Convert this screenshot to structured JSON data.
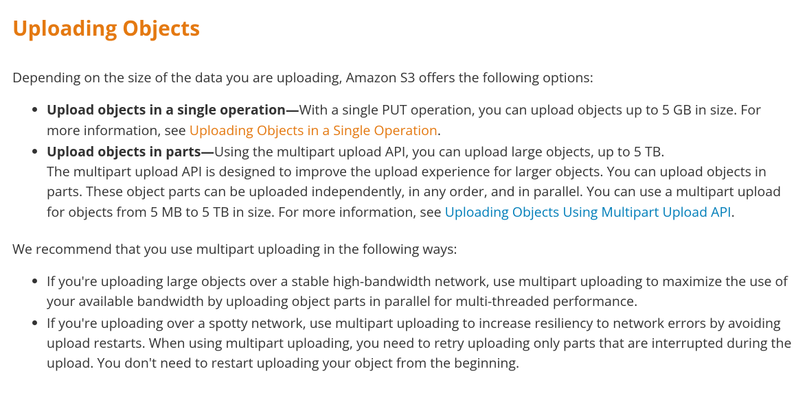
{
  "title": "Uploading Objects",
  "intro": "Depending on the size of the data you are uploading, Amazon S3 offers the following options:",
  "options": [
    {
      "boldPrefix": "Upload objects in a single operation—",
      "textBefore": "With a single PUT operation, you can upload objects up to 5 GB in size. For more information, see ",
      "link": "Uploading Objects in a Single Operation",
      "linkClass": "link-active",
      "textAfter": "."
    },
    {
      "boldPrefix": "Upload objects in parts—",
      "textBefore": "Using the multipart upload API, you can upload large objects, up to 5 TB.\nThe multipart upload API is designed to improve the upload experience for larger objects. You can upload objects in parts. These object parts can be uploaded independently, in any order, and in parallel. You can use a multipart upload for objects from 5 MB to 5 TB in size. For more information, see ",
      "link": "Uploading Objects Using Multipart Upload API",
      "linkClass": "link-visited",
      "textAfter": "."
    }
  ],
  "recommendIntro": "We recommend that you use multipart uploading in the following ways:",
  "recommendations": [
    "If you're uploading large objects over a stable high-bandwidth network, use multipart uploading to maximize the use of your available bandwidth by uploading object parts in parallel for multi-threaded performance.",
    "If you're uploading over a spotty network, use multipart uploading to increase resiliency to network errors by avoiding upload restarts. When using multipart uploading, you need to retry uploading only parts that are interrupted during the upload. You don't need to restart uploading your object from the beginning."
  ]
}
